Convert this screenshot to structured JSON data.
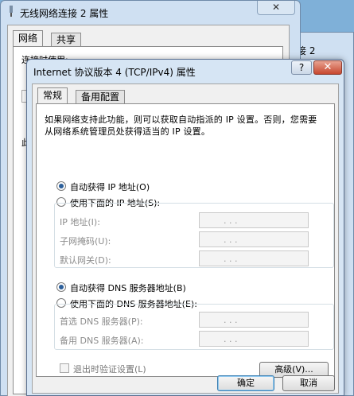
{
  "background_window": {
    "title": "无线网络连接 2 属性",
    "close": "✕",
    "tabs": [
      "网络",
      "共享"
    ],
    "partial_text_1": "连接时使用:",
    "partial_text_2": "此",
    "right_title_fragment": "接 2"
  },
  "dialog": {
    "title": "Internet 协议版本 4 (TCP/IPv4) 属性",
    "help": "?",
    "close": "✕",
    "tabs": [
      "常规",
      "备用配置"
    ],
    "description": "如果网络支持此功能，则可以获取自动指派的 IP 设置。否则，您需要从网络系统管理员处获得适当的 IP 设置。",
    "ip": {
      "auto_label": "自动获得 IP 地址(O)",
      "manual_label": "使用下面的 IP 地址(S):",
      "auto_selected": true,
      "fields": [
        {
          "label": "IP 地址(I):"
        },
        {
          "label": "子网掩码(U):"
        },
        {
          "label": "默认网关(D):"
        }
      ]
    },
    "dns": {
      "auto_label": "自动获得 DNS 服务器地址(B)",
      "manual_label": "使用下面的 DNS 服务器地址(E):",
      "auto_selected": true,
      "fields": [
        {
          "label": "首选 DNS 服务器(P):"
        },
        {
          "label": "备用 DNS 服务器(A):"
        }
      ]
    },
    "validate_label": "退出时验证设置(L)",
    "advanced_button": "高级(V)...",
    "ok_button": "确定",
    "cancel_button": "取消",
    "ip_dots": ".       .       ."
  }
}
